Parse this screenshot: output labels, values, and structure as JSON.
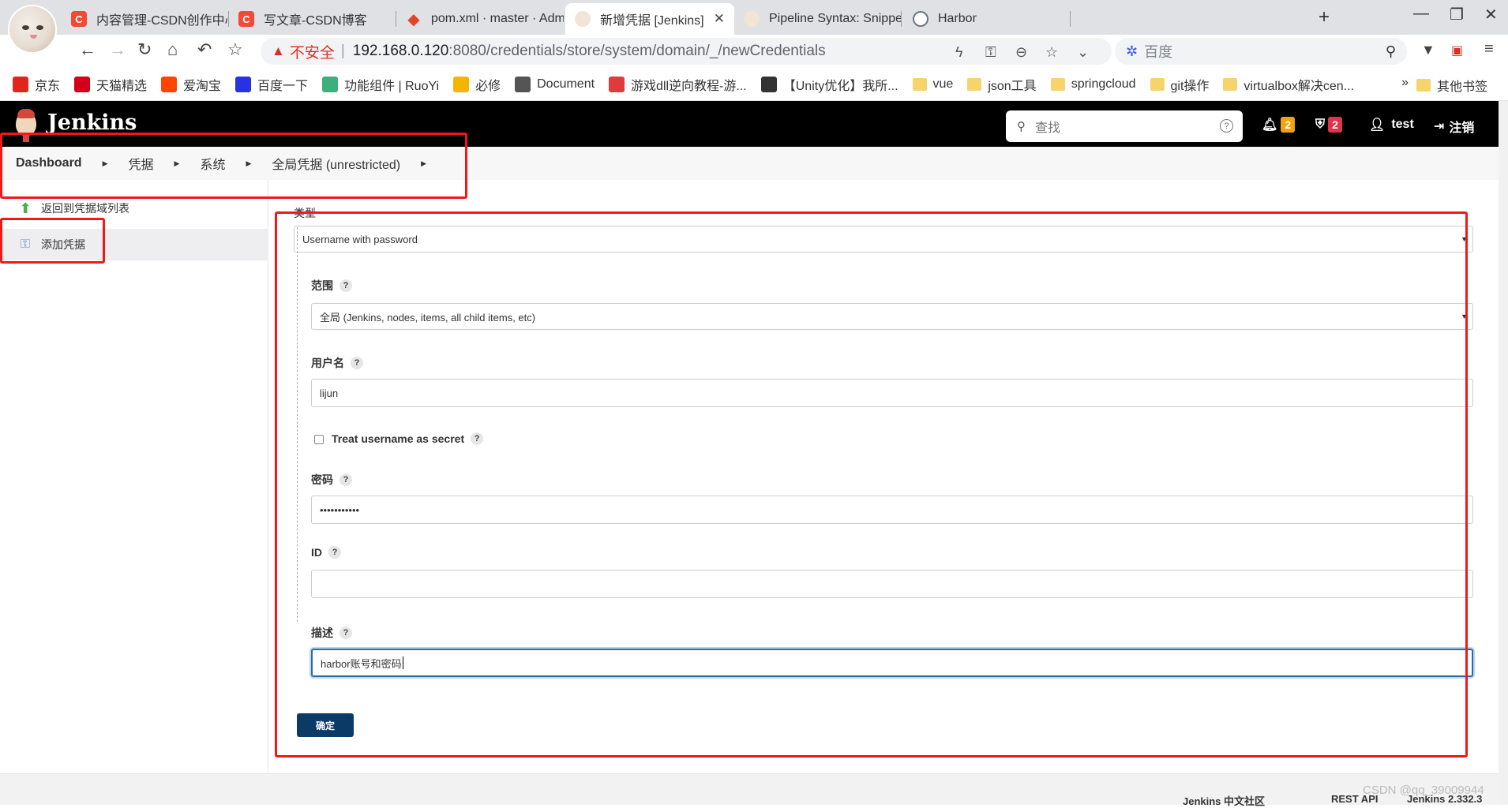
{
  "browser": {
    "tabs": [
      {
        "title": "内容管理-CSDN创作中心",
        "favicon": "csdn-icon"
      },
      {
        "title": "写文章-CSDN博客",
        "favicon": "csdn-icon"
      },
      {
        "title": "pom.xml · master · Administ",
        "favicon": "gitlab-icon"
      },
      {
        "title": "新增凭据 [Jenkins]",
        "favicon": "jenkins-icon",
        "active": true
      },
      {
        "title": "Pipeline Syntax: Snippet Gen",
        "favicon": "jenkins-icon"
      },
      {
        "title": "Harbor",
        "favicon": "harbor-icon"
      }
    ],
    "address": {
      "warning": "不安全",
      "host": "192.168.0.120",
      "rest": ":8080/credentials/store/system/domain/_/newCredentials"
    },
    "search_placeholder": "百度",
    "bookmarks": [
      {
        "label": "京东",
        "icon": "jd-icon",
        "color": "#e1251b"
      },
      {
        "label": "天猫精选",
        "icon": "tmall-icon",
        "color": "#d4001b"
      },
      {
        "label": "爱淘宝",
        "icon": "taobao-icon",
        "color": "#ff4400"
      },
      {
        "label": "百度一下",
        "icon": "baidu-icon",
        "color": "#2932e1"
      },
      {
        "label": "功能组件 | RuoYi",
        "icon": "ruoyi-icon",
        "color": "#3eaf7c"
      },
      {
        "label": "必修",
        "icon": "bixiu-icon",
        "color": "#f5b400"
      },
      {
        "label": "Document",
        "icon": "globe-icon",
        "color": "#555555"
      },
      {
        "label": "游戏dll逆向教程-游...",
        "icon": "tutorial-icon",
        "color": "#e03a3a"
      },
      {
        "label": "【Unity优化】我所...",
        "icon": "unity-icon",
        "color": "#333333"
      },
      {
        "label": "vue",
        "icon": "folder-icon"
      },
      {
        "label": "json工具",
        "icon": "folder-icon"
      },
      {
        "label": "springcloud",
        "icon": "folder-icon"
      },
      {
        "label": "git操作",
        "icon": "folder-icon"
      },
      {
        "label": "virtualbox解决cen...",
        "icon": "folder-icon"
      }
    ],
    "bookmarks_more": "»",
    "bookmarks_other": "其他书签"
  },
  "jenkins": {
    "title": "Jenkins",
    "search_placeholder": "查找",
    "notifications": "2",
    "security_warnings": "2",
    "user": "test",
    "logout": "注销"
  },
  "breadcrumb": [
    "Dashboard",
    "凭据",
    "系统",
    "全局凭据 (unrestricted)"
  ],
  "sidepanel": {
    "back": "返回到凭据域列表",
    "add": "添加凭据"
  },
  "form": {
    "kind_label": "类型",
    "kind_value": "Username with password",
    "scope_label": "范围",
    "scope_value": "全局 (Jenkins, nodes, items, all child items, etc)",
    "username_label": "用户名",
    "username_value": "lijun",
    "treat_secret_label": "Treat username as secret",
    "treat_secret_checked": false,
    "password_label": "密码",
    "password_value": "•••••••••••",
    "id_label": "ID",
    "id_value": "",
    "description_label": "描述",
    "description_value": "harbor账号和密码",
    "help": "?",
    "submit": "确定"
  },
  "footer": {
    "community": "Jenkins 中文社区",
    "rest_api": "REST API",
    "version": "Jenkins 2.332.3"
  },
  "watermark": "CSDN @qq_39009944",
  "colors": {
    "annotation_red": "#f01919",
    "jenkins_header": "#000000",
    "submit_button": "#0b3a66"
  }
}
